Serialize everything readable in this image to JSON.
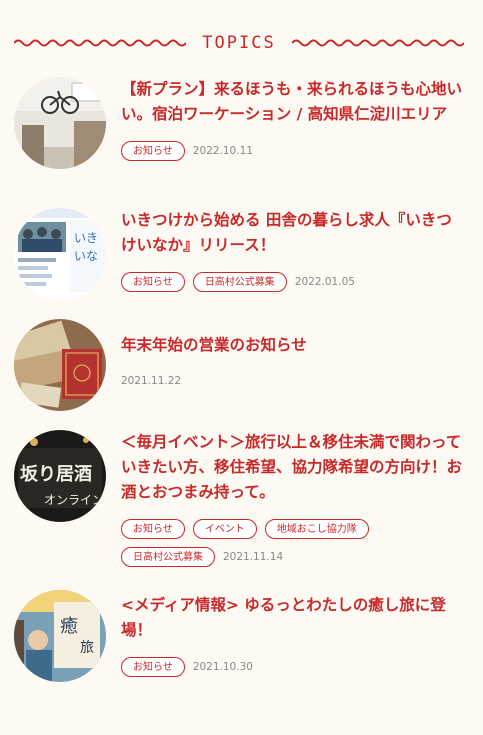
{
  "section": {
    "title": "TOPICS"
  },
  "posts": [
    {
      "title": "【新プラン】来るほうも・来られるほうも心地いい。宿泊ワーケーション / 高知県仁淀川エリア",
      "tags": [
        "お知らせ"
      ],
      "date": "2022.10.11",
      "thumb_icon": "bicycle-room-photo"
    },
    {
      "title": "いきつけから始める 田舎の暮らし求人『いきつけいなか』リリース！",
      "tags": [
        "お知らせ",
        "日高村公式募集"
      ],
      "date": "2022.01.05",
      "thumb_icon": "website-people-photo",
      "thumb_text": "いき いな"
    },
    {
      "title": "年末年始の営業のお知らせ",
      "tags": [],
      "date": "2021.11.22",
      "thumb_icon": "money-notebook-photo"
    },
    {
      "title": "＜毎月イベント＞旅行以上＆移住未満で関わっていきたい方、移住希望、協力隊希望の方向け！お酒とおつまみ持って。",
      "tags": [
        "お知らせ",
        "イベント",
        "地域おこし協力隊",
        "日高村公式募集"
      ],
      "date": "2021.11.14",
      "thumb_icon": "online-izakaya-sign-photo",
      "thumb_text": "坂り居酒 オンライン"
    },
    {
      "title": "<メディア情報> ゆるっとわたしの癒し旅に登場！",
      "tags": [
        "お知らせ"
      ],
      "date": "2021.10.30",
      "thumb_icon": "magazine-person-photo",
      "thumb_text": "癒 旅"
    }
  ],
  "colors": {
    "accent": "#c8292b",
    "background": "#fdf9f3",
    "date": "#8a8a8a"
  }
}
